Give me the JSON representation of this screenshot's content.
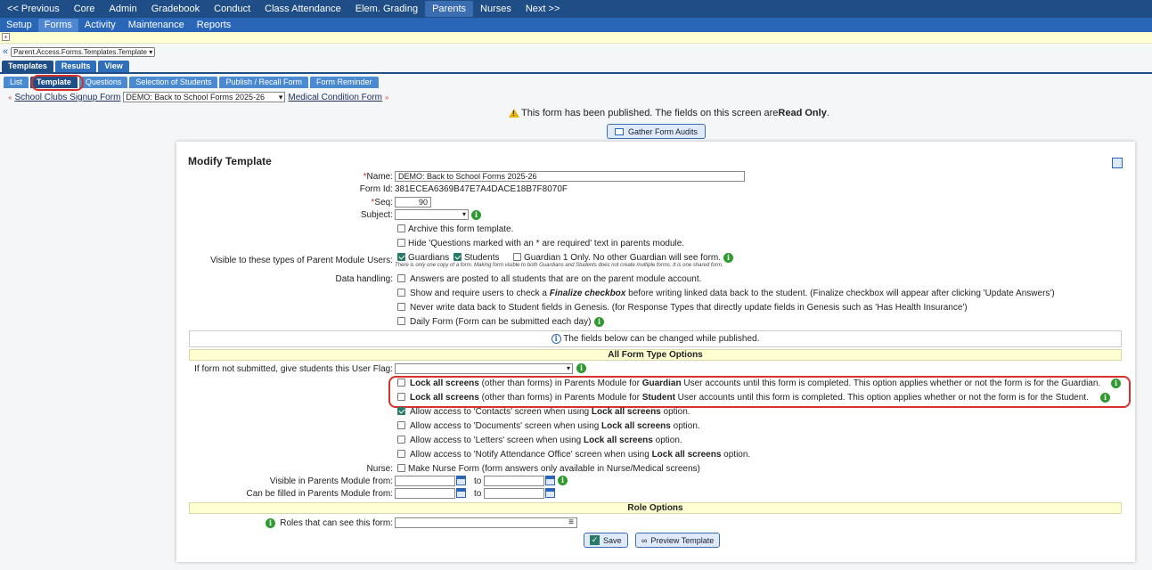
{
  "top_nav": [
    "<< Previous",
    "Core",
    "Admin",
    "Gradebook",
    "Conduct",
    "Class Attendance",
    "Elem. Grading",
    "Parents",
    "Nurses",
    "Next >>"
  ],
  "top_nav_active": "Parents",
  "sub_nav": [
    "Setup",
    "Forms",
    "Activity",
    "Maintenance",
    "Reports"
  ],
  "sub_nav_active": "Forms",
  "breadcrumb_select": "Parent.Access.Forms.Templates.Template",
  "tabs_level1": [
    "Templates",
    "Results",
    "View"
  ],
  "tabs_level2": [
    "List",
    "Template",
    "Questions",
    "Selection of Students",
    "Publish / Recall Form",
    "Form Reminder"
  ],
  "form_nav": {
    "prev": "School Clubs Signup Form",
    "current": "DEMO: Back to School Forms 2025-26",
    "next": "Medical Condition Form"
  },
  "notice": {
    "prefix": "This form has been published. The fields on this screen are ",
    "bold": "Read Only",
    "suffix": "."
  },
  "gather_button": "Gather Form Audits",
  "panel": {
    "title": "Modify Template",
    "name_label": "Name:",
    "name_value": "DEMO: Back to School Forms 2025-26",
    "formid_label": "Form Id:",
    "formid_value": "381ECEA6369B47E7A4DACE18B7F8070F",
    "seq_label": "Seq:",
    "seq_value": "90",
    "subject_label": "Subject:",
    "archive_label": "Archive this form template.",
    "hide_label": "Hide 'Questions marked with an * are required' text in parents module.",
    "visible_label": "Visible to these types of Parent Module Users:",
    "guardians": "Guardians",
    "students": "Students",
    "guardian1": "Guardian 1 Only. No other Guardian will see form.",
    "visible_note": "There is only one copy of a form. Making form visible to both Guardians and Students does not create multiple forms. It is one shared form.",
    "data_label": "Data handling:",
    "data_opt1": "Answers are posted to all students that are on the parent module account.",
    "data_opt2_a": "Show and require users to check a ",
    "data_opt2_b": "Finalize checkbox",
    "data_opt2_c": " before writing linked data back to the student. (Finalize checkbox will appear after clicking 'Update Answers')",
    "data_opt3": "Never write data back to Student fields in Genesis. (for Response Types that directly update fields in Genesis such as 'Has Health Insurance')",
    "data_opt4": "Daily Form (Form can be submitted each day)",
    "published_note": "The fields below can be changed while published.",
    "section_all": "All Form Type Options",
    "flag_label": "If form not submitted, give students this User Flag:",
    "lock_guardian_a": "Lock all screens",
    "lock_guardian_b": " (other than forms) in Parents Module for ",
    "lock_guardian_c": "Guardian",
    "lock_guardian_d": " User accounts until this form is completed. This option applies whether or not the form is for the Guardian.",
    "lock_student_a": "Lock all screens",
    "lock_student_b": " (other than forms) in Parents Module for ",
    "lock_student_c": "Student",
    "lock_student_d": " User accounts until this form is completed. This option applies whether or not the form is for the Student.",
    "allow_contacts_a": "Allow access to 'Contacts' screen when using ",
    "allow_contacts_b": "Lock all screens",
    "allow_contacts_c": " option.",
    "allow_documents_a": "Allow access to 'Documents' screen when using ",
    "allow_documents_b": "Lock all screens",
    "allow_documents_c": " option.",
    "allow_letters_a": "Allow access to 'Letters' screen when using ",
    "allow_letters_b": "Lock all screens",
    "allow_letters_c": " option.",
    "allow_notify_a": "Allow access to 'Notify Attendance Office' screen when using ",
    "allow_notify_b": "Lock all screens",
    "allow_notify_c": " option.",
    "nurse_label": "Nurse:",
    "nurse_opt": "Make Nurse Form (form answers only available in Nurse/Medical screens)",
    "visible_from_label": "Visible in Parents Module from:",
    "fill_from_label": "Can be filled in Parents Module from:",
    "to": "to",
    "section_role": "Role Options",
    "roles_label": "Roles that can see this form:",
    "save": "Save",
    "preview": "Preview Template"
  }
}
